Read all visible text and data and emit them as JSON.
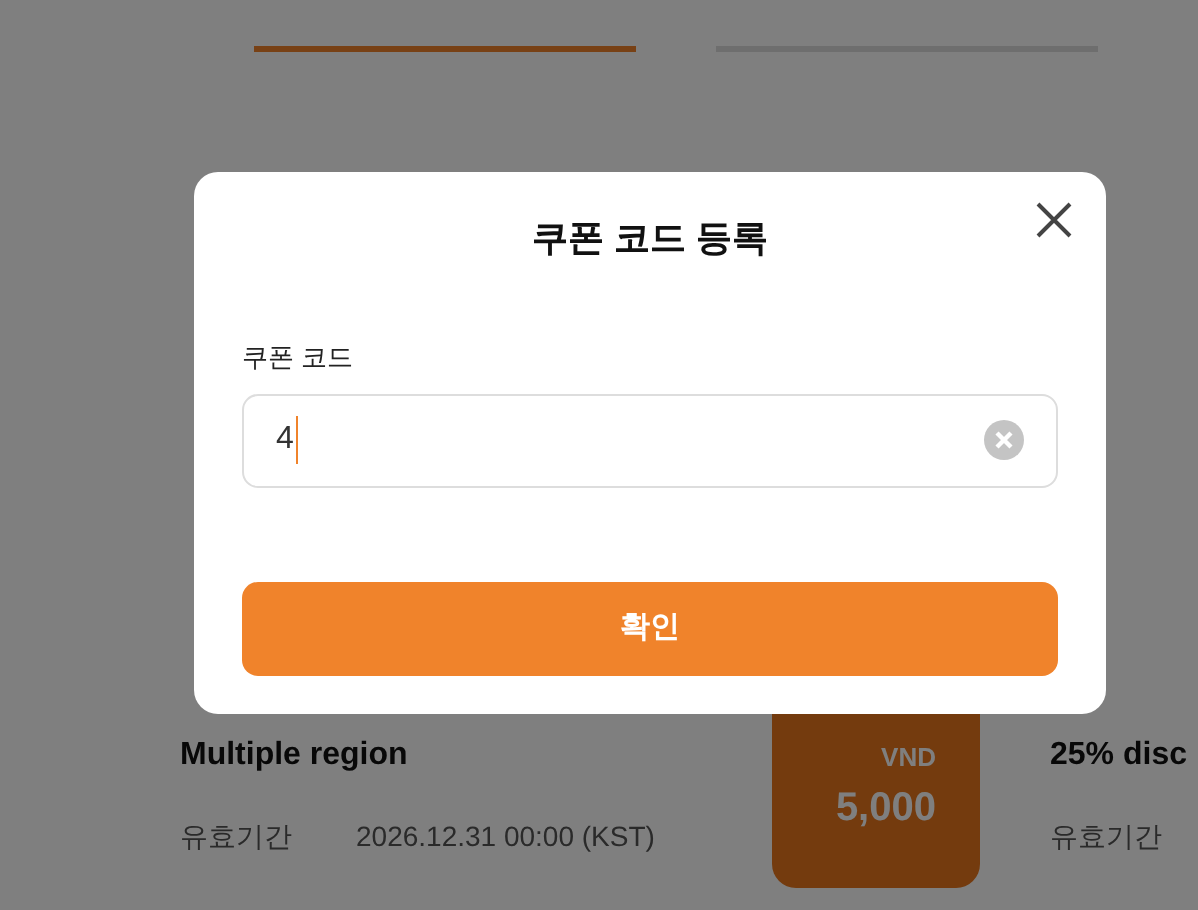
{
  "background": {
    "tabs": [
      {
        "selected": true
      },
      {
        "selected": false
      }
    ],
    "cards": [
      {
        "title": "Multiple region",
        "validity_label": "유효기간",
        "validity": "2026.12.31 00:00 (KST)",
        "currency": "VND",
        "amount": "5,000"
      },
      {
        "title": "25% disc",
        "validity_label": "유효기간"
      }
    ]
  },
  "modal": {
    "title": "쿠폰 코드 등록",
    "field_label": "쿠폰 코드",
    "field_value": "4",
    "confirm": "확인"
  }
}
